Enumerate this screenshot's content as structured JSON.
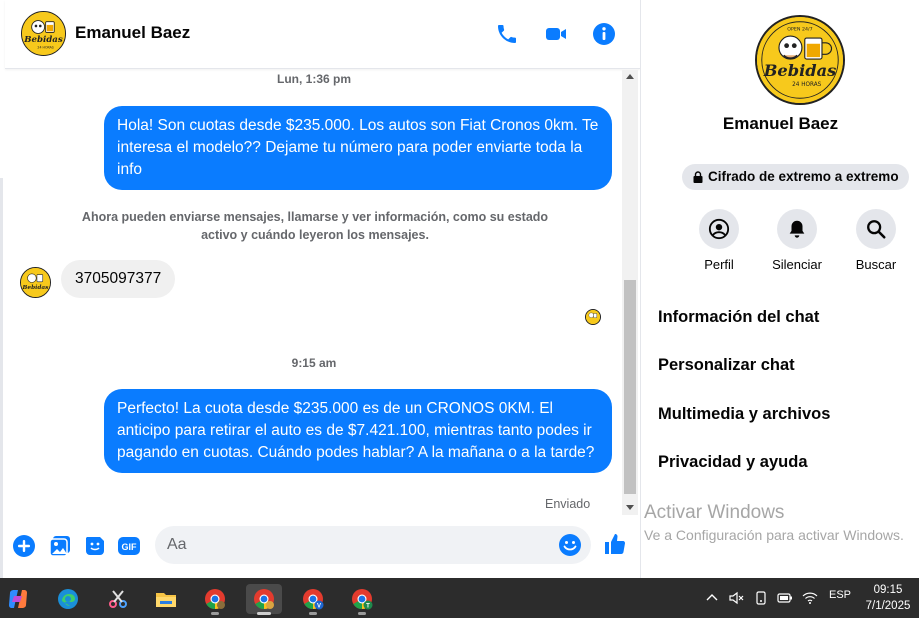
{
  "contact": {
    "name": "Emanuel Baez",
    "avatar_brand": "Bebidas",
    "avatar_sub": "24 HORAS",
    "avatar_top": "OPEN 24/7"
  },
  "header": {
    "call_icon": "phone-icon",
    "video_icon": "video-camera-icon",
    "info_icon": "info-icon"
  },
  "messages": {
    "timestamp_1": "Lun, 1:36 pm",
    "out_1": "Hola! Son cuotas desde $235.000. Los autos son Fiat Cronos 0km. Te interesa el modelo?? Dejame tu número para poder enviarte toda la info",
    "notice": "Ahora pueden enviarse mensajes, llamarse y ver información, como su estado activo y cuándo leyeron los mensajes.",
    "in_1": "3705097377",
    "timestamp_2": "9:15 am",
    "out_2": "Perfecto! La cuota desde $235.000 es de un CRONOS 0KM. El anticipo para retirar el auto es de $7.421.100, mientras tanto podes ir pagando en cuotas. Cuándo podes hablar? A la mañana o a la tarde?",
    "status": "Enviado"
  },
  "composer": {
    "placeholder": "Aa",
    "gif_label": "GIF"
  },
  "panel": {
    "encryption": "Cifrado de extremo a extremo",
    "actions": [
      {
        "label": "Perfil"
      },
      {
        "label": "Silenciar"
      },
      {
        "label": "Buscar"
      }
    ],
    "menu": [
      {
        "label": "Información del chat"
      },
      {
        "label": "Personalizar chat"
      },
      {
        "label": "Multimedia y archivos"
      },
      {
        "label": "Privacidad y ayuda"
      }
    ]
  },
  "watermark": {
    "title": "Activar Windows",
    "subtitle": "Ve a Configuración para activar Windows."
  },
  "taskbar": {
    "language": "ESP",
    "time": "09:15",
    "date": "7/1/2025",
    "profile_v": "V",
    "profile_t": "T"
  },
  "colors": {
    "accent": "#0a7cff",
    "incoming_bubble": "#f0f0f0",
    "avatar_yellow": "#f7c91c",
    "taskbar": "#2c2c2c"
  }
}
